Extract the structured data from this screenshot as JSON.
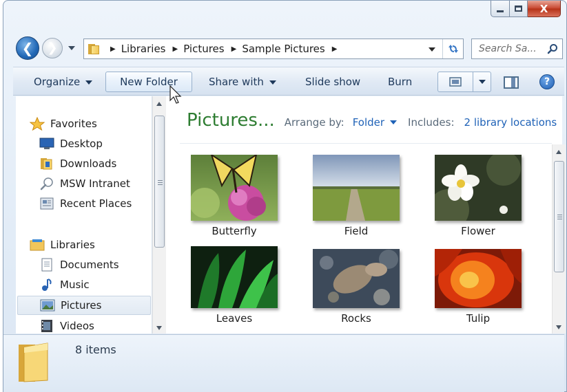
{
  "window": {
    "caption_buttons": {
      "minimize": "—",
      "maximize": "□",
      "close": "X"
    }
  },
  "navbar": {
    "breadcrumbs": [
      "Libraries",
      "Pictures",
      "Sample Pictures"
    ],
    "search_placeholder": "Search Sa..."
  },
  "cmdbar": {
    "organize": "Organize",
    "new_folder": "New Folder",
    "share_with": "Share with",
    "slide_show": "Slide show",
    "burn": "Burn",
    "help": "?"
  },
  "nav_pane": {
    "favorites_header": "Favorites",
    "favorites": [
      "Desktop",
      "Downloads",
      "MSW Intranet",
      "Recent Places"
    ],
    "libraries_header": "Libraries",
    "libraries": [
      "Documents",
      "Music",
      "Pictures",
      "Videos"
    ],
    "selected": "Pictures"
  },
  "content": {
    "title": "Pictures...",
    "arrange_by_label": "Arrange by:",
    "arrange_by_value": "Folder",
    "includes_label": "Includes:",
    "includes_link": "2 library locations",
    "thumbnails": [
      "Butterfly",
      "Field",
      "Flower",
      "Leaves",
      "Rocks",
      "Tulip"
    ]
  },
  "details": {
    "items_count": "8 items"
  },
  "icons": {
    "back": "arrow-left-icon",
    "forward": "arrow-right-icon",
    "refresh": "refresh-icon",
    "search": "search-icon",
    "help": "help-icon"
  },
  "colors": {
    "title_green": "#2e7d32",
    "link_blue": "#1f62b7",
    "command_text": "#1e395b"
  }
}
